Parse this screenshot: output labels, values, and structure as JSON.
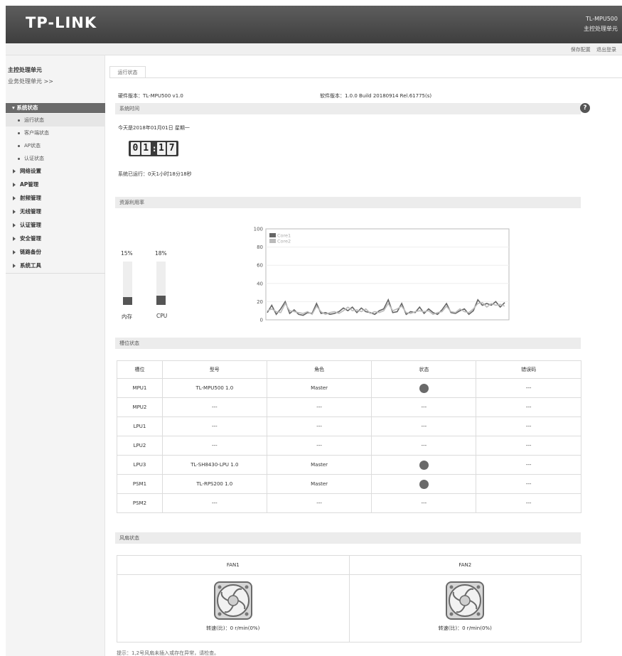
{
  "header": {
    "logo": "TP-LINK",
    "model": "TL-MPU500",
    "unit": "主控处理单元"
  },
  "topbar": {
    "save": "保存配置",
    "logout": "退出登录"
  },
  "sidebar": {
    "title": "主控处理单元",
    "sub": "业务处理单元 >>",
    "section": "系统状态",
    "children": [
      "运行状态",
      "客户端状态",
      "AP状态",
      "认证状态"
    ],
    "menus": [
      "网络设置",
      "AP管理",
      "射频管理",
      "无线管理",
      "认证管理",
      "安全管理",
      "链路备份",
      "系统工具"
    ]
  },
  "tab": "运行状态",
  "info": {
    "hardware": "硬件版本：TL-MPU500 v1.0",
    "software": "软件版本：1.0.0 Build 20180914 Rel.61775(s)"
  },
  "systime": {
    "heading": "系统时间",
    "today": "今天是2018年01月01日 星期一",
    "clock": [
      "0",
      "1",
      "1",
      "7"
    ],
    "uptime": "系统已运行：0天1小时18分18秒"
  },
  "resources": {
    "heading": "资源利用率",
    "memory": {
      "label": "内存",
      "value_text": "15%",
      "value": 15
    },
    "cpu": {
      "label": "CPU",
      "value_text": "18%",
      "value": 18
    }
  },
  "chart_data": {
    "type": "line",
    "title": "",
    "ylim": [
      0,
      100
    ],
    "yticks": [
      "0",
      "20",
      "40",
      "60",
      "80",
      "100"
    ],
    "legend": "top-left",
    "series": [
      {
        "name": "Core1",
        "color": "#666666",
        "values": [
          8,
          16,
          6,
          12,
          20,
          7,
          11,
          6,
          5,
          8,
          7,
          18,
          7,
          8,
          6,
          7,
          9,
          13,
          10,
          14,
          8,
          13,
          9,
          8,
          6,
          10,
          12,
          22,
          8,
          9,
          18,
          6,
          9,
          8,
          14,
          7,
          12,
          8,
          6,
          11,
          18,
          8,
          7,
          10,
          12,
          6,
          10,
          22,
          16,
          18,
          16,
          20,
          14,
          19
        ]
      },
      {
        "name": "Core2",
        "color": "#bbbbbb",
        "values": [
          10,
          12,
          9,
          8,
          18,
          10,
          9,
          8,
          7,
          9,
          6,
          15,
          9,
          6,
          8,
          9,
          7,
          10,
          14,
          10,
          11,
          9,
          12,
          7,
          9,
          8,
          10,
          18,
          10,
          12,
          15,
          8,
          7,
          9,
          10,
          9,
          10,
          6,
          8,
          9,
          15,
          9,
          8,
          12,
          9,
          8,
          12,
          18,
          19,
          14,
          18,
          16,
          17,
          15
        ]
      }
    ]
  },
  "slots": {
    "heading": "槽位状态",
    "columns": [
      "槽位",
      "型号",
      "角色",
      "状态",
      "错误码"
    ],
    "rows": [
      {
        "slot": "MPU1",
        "model": "TL-MPU500 1.0",
        "role": "Master",
        "status": "dot",
        "error": "---"
      },
      {
        "slot": "MPU2",
        "model": "---",
        "role": "---",
        "status": "---",
        "error": "---"
      },
      {
        "slot": "LPU1",
        "model": "---",
        "role": "---",
        "status": "---",
        "error": "---"
      },
      {
        "slot": "LPU2",
        "model": "---",
        "role": "---",
        "status": "---",
        "error": "---"
      },
      {
        "slot": "LPU3",
        "model": "TL-SH8430-LPU 1.0",
        "role": "Master",
        "status": "dot",
        "error": "---"
      },
      {
        "slot": "PSM1",
        "model": "TL-RPS200 1.0",
        "role": "Master",
        "status": "dot",
        "error": "---"
      },
      {
        "slot": "PSM2",
        "model": "---",
        "role": "---",
        "status": "---",
        "error": "---"
      }
    ]
  },
  "fans": {
    "heading": "风扇状态",
    "items": [
      {
        "name": "FAN1",
        "speed": "转速(比)：0 r/min(0%)"
      },
      {
        "name": "FAN2",
        "speed": "转速(比)：0 r/min(0%)"
      }
    ],
    "note": "提示：1,2号风扇未插入或存在异常，请检查。"
  }
}
